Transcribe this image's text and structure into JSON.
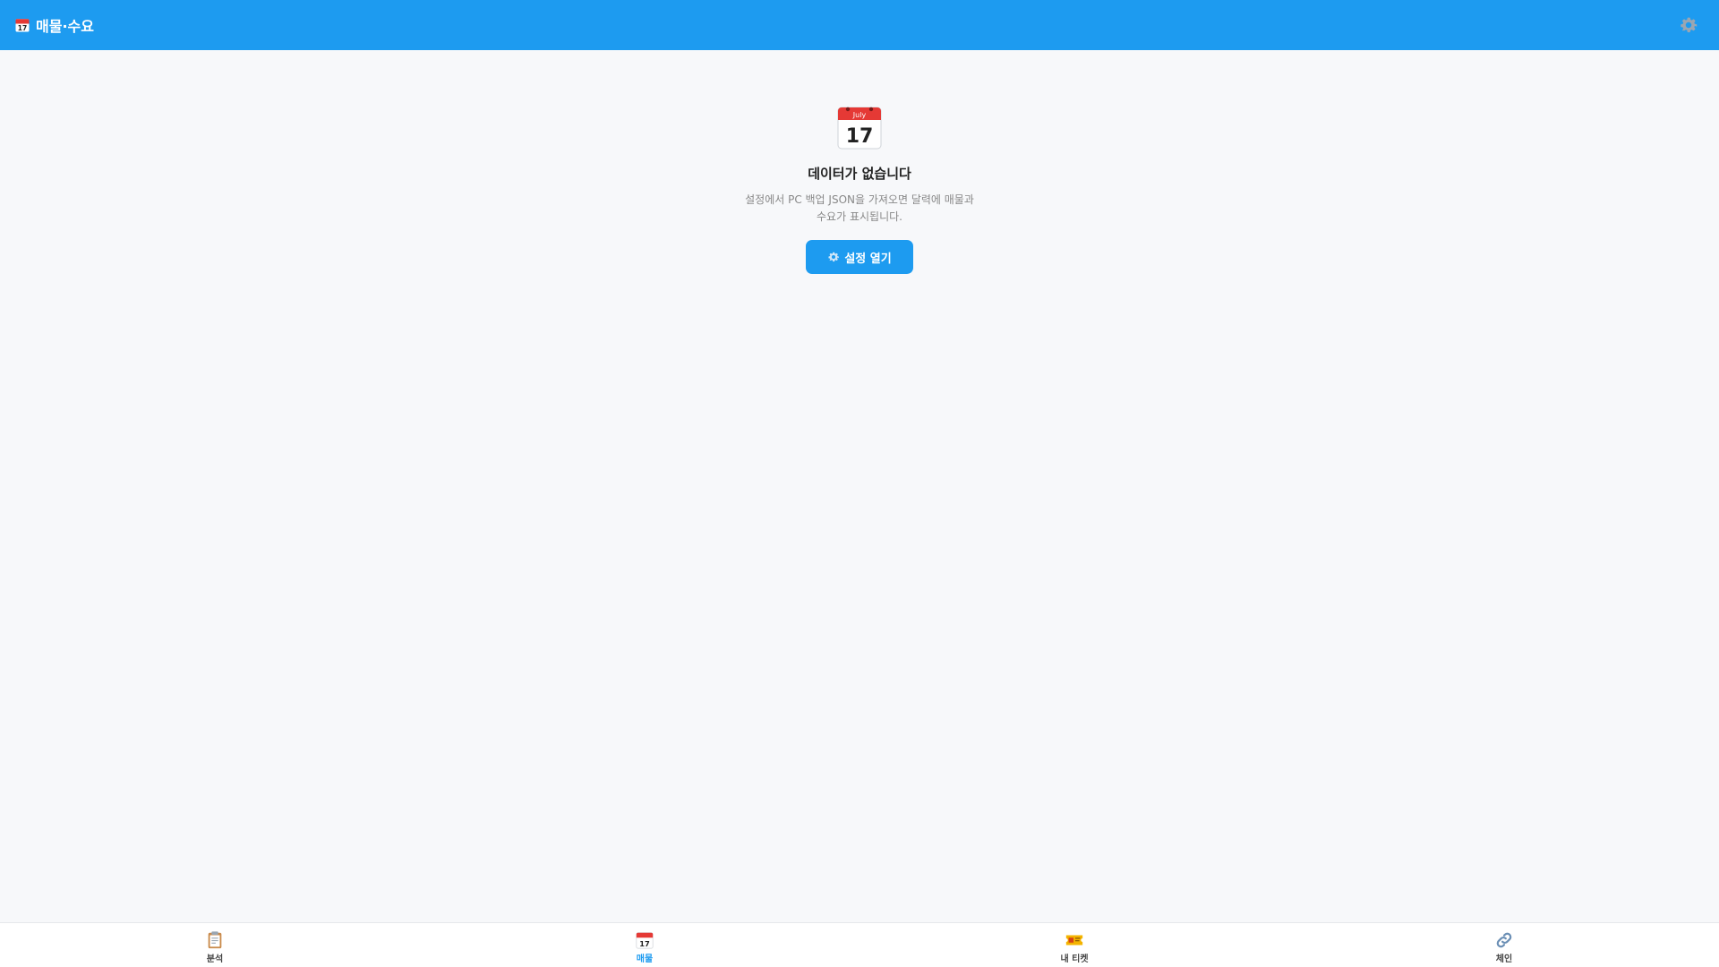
{
  "header": {
    "title": "매물·수요",
    "title_icon": "calendar-icon",
    "settings_icon": "gear-icon"
  },
  "empty_state": {
    "icon": "calendar-icon",
    "title": "데이터가 없습니다",
    "description": "설정에서 PC 백업 JSON을 가져오면 달력에 매물과 수요가 표시됩니다.",
    "button_label": "설정 열기",
    "button_icon": "gear-icon"
  },
  "bottom_nav": {
    "items": [
      {
        "label": "분석",
        "icon": "clipboard-icon",
        "active": false
      },
      {
        "label": "매물",
        "icon": "calendar-icon",
        "active": true
      },
      {
        "label": "내 티켓",
        "icon": "ticket-icon",
        "active": false
      },
      {
        "label": "체인",
        "icon": "link-icon",
        "active": false
      }
    ]
  },
  "colors": {
    "primary": "#1d9bf0",
    "background": "#f7f8fa",
    "text_muted": "#888888"
  }
}
